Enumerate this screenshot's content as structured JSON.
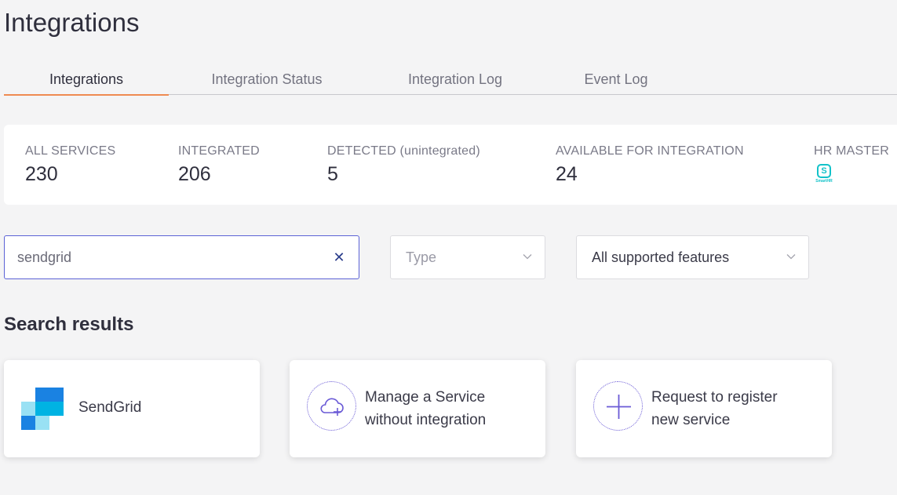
{
  "page_title": "Integrations",
  "tabs": [
    {
      "label": "Integrations",
      "active": true
    },
    {
      "label": "Integration Status",
      "active": false
    },
    {
      "label": "Integration Log",
      "active": false
    },
    {
      "label": "Event Log",
      "active": false
    }
  ],
  "stats": {
    "all_services": {
      "label": "ALL SERVICES",
      "value": "230"
    },
    "integrated": {
      "label": "INTEGRATED",
      "value": "206"
    },
    "detected": {
      "label": "DETECTED (unintegrated)",
      "value": "5"
    },
    "available": {
      "label": "AVAILABLE FOR INTEGRATION",
      "value": "24"
    },
    "hr_master": {
      "label": "HR MASTER",
      "logo_letter": "S",
      "logo_text": "SmartHR"
    }
  },
  "filters": {
    "search_value": "sendgrid",
    "clear_glyph": "✕",
    "type_placeholder": "Type",
    "features_value": "All supported features"
  },
  "results": {
    "title": "Search results",
    "cards": [
      {
        "label": "SendGrid"
      },
      {
        "label_line1": "Manage a Service",
        "label_line2": "without integration"
      },
      {
        "label_line1": "Request to register",
        "label_line2": "new service"
      }
    ]
  },
  "colors": {
    "accent_tab": "#ef8a51",
    "focus_border": "#5b62d6",
    "icon_purple": "#6a5ad6",
    "smarthr": "#12c2c9"
  }
}
